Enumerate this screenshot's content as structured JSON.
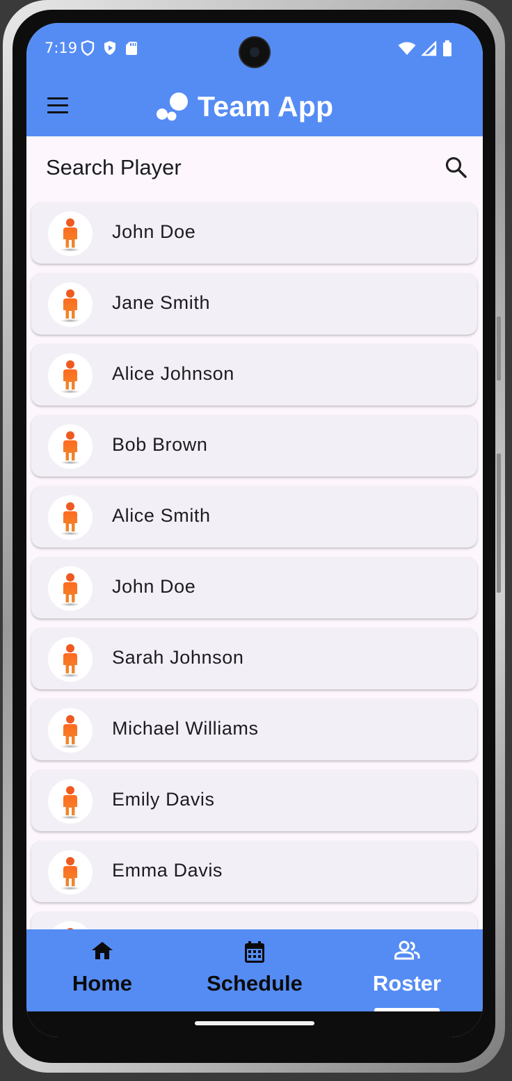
{
  "status_bar": {
    "time": "7:19",
    "left_icons": [
      "shield-outline-icon",
      "shield-play-icon",
      "sd-card-icon"
    ],
    "right_icons": [
      "wifi-icon",
      "cell-signal-icon",
      "battery-icon"
    ]
  },
  "app_bar": {
    "title": "Team App",
    "logo_icon": "bubbles-logo-icon",
    "menu_icon": "hamburger-menu-icon"
  },
  "search": {
    "placeholder": "Search Player",
    "icon": "search-icon"
  },
  "players": [
    {
      "name": "John Doe"
    },
    {
      "name": "Jane Smith"
    },
    {
      "name": "Alice Johnson"
    },
    {
      "name": "Bob Brown"
    },
    {
      "name": "Alice Smith"
    },
    {
      "name": "John Doe"
    },
    {
      "name": "Sarah Johnson"
    },
    {
      "name": "Michael Williams"
    },
    {
      "name": "Emily Davis"
    },
    {
      "name": "Emma Davis"
    },
    {
      "name": ""
    }
  ],
  "bottom_nav": {
    "items": [
      {
        "label": "Home",
        "icon": "home-icon"
      },
      {
        "label": "Schedule",
        "icon": "calendar-icon"
      },
      {
        "label": "Roster",
        "icon": "people-icon",
        "active": true
      }
    ]
  },
  "colors": {
    "primary": "#558cf4",
    "background": "#fdf7fd",
    "card": "#f3eff6",
    "avatar_figure": "#f07a2b"
  }
}
